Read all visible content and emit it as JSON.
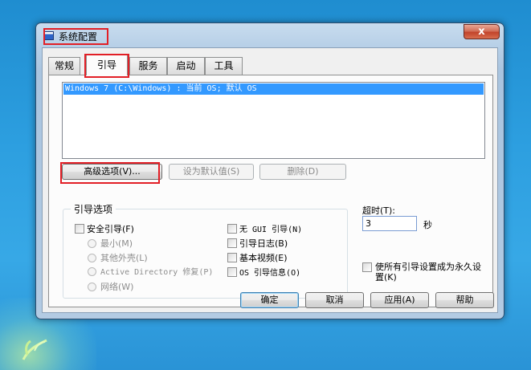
{
  "window": {
    "title": "系统配置",
    "close_label": "x"
  },
  "tabs": [
    "常规",
    "引导",
    "服务",
    "启动",
    "工具"
  ],
  "active_tab": "引导",
  "os_list": {
    "items": [
      "Windows 7 (C:\\Windows) : 当前 OS; 默认 OS"
    ]
  },
  "buttons": {
    "advanced": "高级选项(V)...",
    "set_default": "设为默认值(S)",
    "delete": "删除(D)"
  },
  "boot_options": {
    "title": "引导选项",
    "safe_boot": "安全引导(F)",
    "minimal": "最小(M)",
    "alternate_shell": "其他外壳(L)",
    "active_directory_repair": "Active Directory 修复(P)",
    "network": "网络(W)",
    "no_gui_boot": "无 GUI 引导(N)",
    "boot_log": "引导日志(B)",
    "base_video": "基本视频(E)",
    "os_boot_info": "OS 引导信息(O)"
  },
  "timeout": {
    "label": "超时(T):",
    "value": "3",
    "unit": "秒"
  },
  "make_permanent": "使所有引导设置成为永久设置(K)",
  "dialog_buttons": {
    "ok": "确定",
    "cancel": "取消",
    "apply": "应用(A)",
    "help": "帮助"
  },
  "colors": {
    "selection": "#3399ff",
    "highlight_annotation": "#e21f26"
  }
}
